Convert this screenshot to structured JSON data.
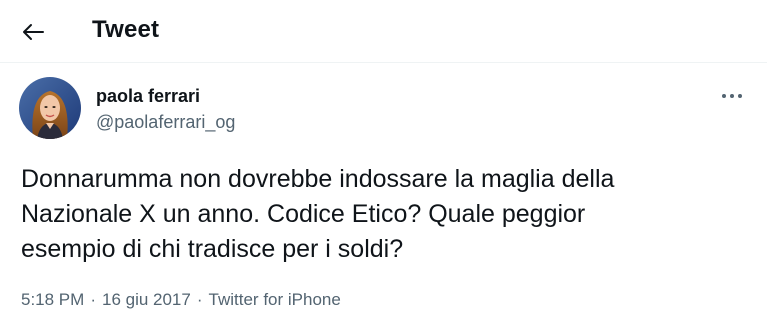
{
  "header": {
    "title": "Tweet",
    "back_icon": "arrow-left-icon"
  },
  "tweet": {
    "author": {
      "display_name": "paola ferrari",
      "handle": "@paolaferrari_og"
    },
    "more_icon": "more-horizontal-icon",
    "text": "Donnarumma non dovrebbe indossare la maglia della\nNazionale X un anno. Codice Etico? Quale peggior\nesempio di chi tradisce per i soldi?",
    "time": "5:18 PM",
    "date": "16 giu 2017",
    "source": "Twitter for iPhone",
    "separator": "·"
  },
  "colors": {
    "text_primary": "#0f1419",
    "text_secondary": "#536471",
    "divider": "#eff3f4",
    "background": "#ffffff"
  }
}
